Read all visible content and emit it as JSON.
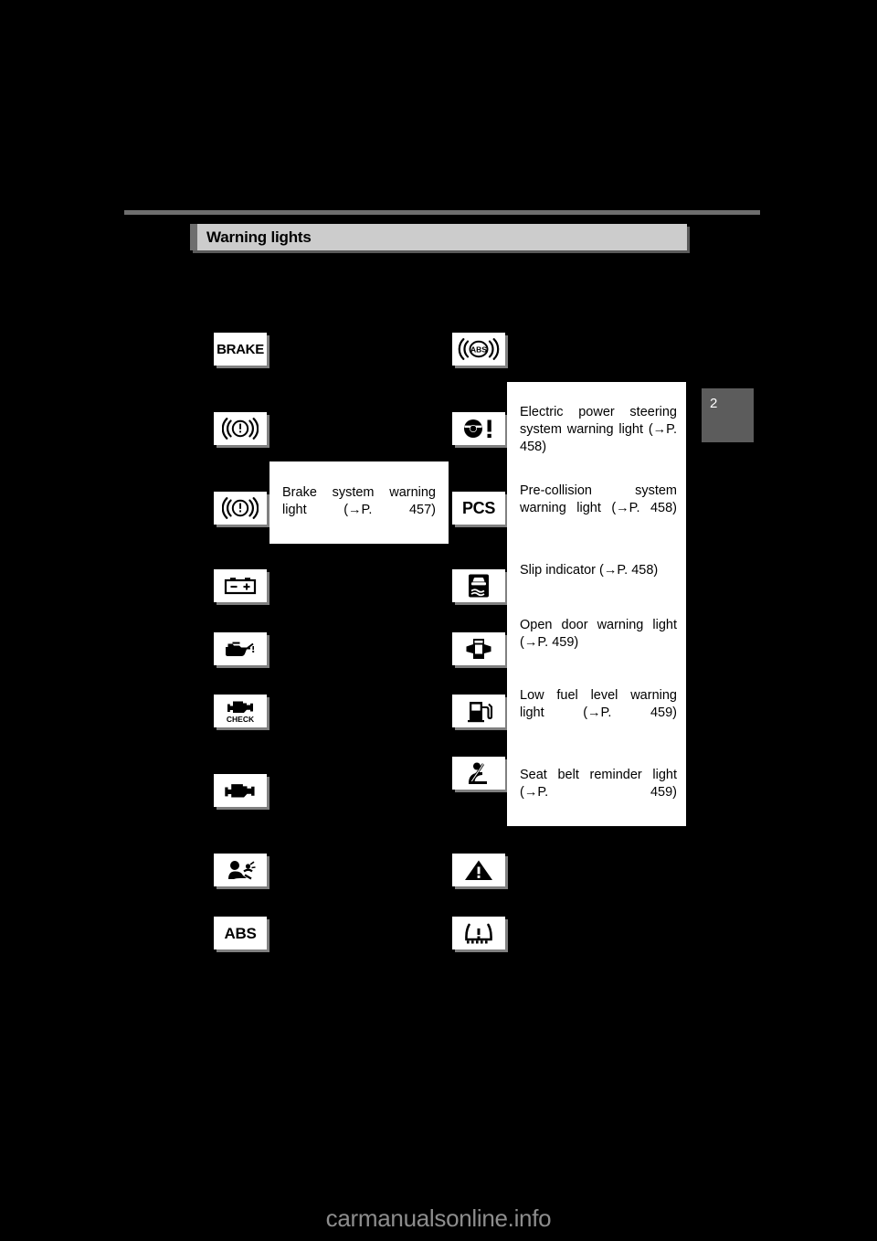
{
  "page": {
    "chapter_tab": "2",
    "watermark": "carmanualsonline.info",
    "background_color": "#000000",
    "header_bg": "#cccccc",
    "accent_color": "#6e6e6e"
  },
  "header": {
    "title": "Warning lights"
  },
  "left_column": {
    "icons": [
      {
        "name": "brake-warning-text-icon",
        "label": "BRAKE",
        "kind": "text"
      },
      {
        "name": "brake-system-warning-icon",
        "label": "",
        "kind": "brake-circle"
      },
      {
        "name": "brake-system-warning-icon-2",
        "label": "",
        "kind": "brake-circle"
      },
      {
        "name": "charging-system-warning-icon",
        "label": "",
        "kind": "battery"
      },
      {
        "name": "low-engine-oil-pressure-warning-icon",
        "label": "",
        "kind": "oil-can"
      },
      {
        "name": "check-engine-warning-icon",
        "label": "CHECK",
        "kind": "engine-check"
      },
      {
        "name": "malfunction-indicator-lamp-icon",
        "label": "",
        "kind": "engine"
      },
      {
        "name": "srs-airbag-warning-icon",
        "label": "",
        "kind": "airbag"
      },
      {
        "name": "abs-warning-text-icon",
        "label": "ABS",
        "kind": "text"
      }
    ]
  },
  "right_column": {
    "icons": [
      {
        "name": "abs-warning-icon",
        "label": "ABS",
        "kind": "abs-brackets"
      },
      {
        "name": "electric-power-steering-warning-icon",
        "label": "",
        "kind": "steering-wheel"
      },
      {
        "name": "pre-collision-system-warning-icon",
        "label": "PCS",
        "kind": "text"
      },
      {
        "name": "slip-indicator-icon",
        "label": "",
        "kind": "slip"
      },
      {
        "name": "open-door-warning-icon",
        "label": "",
        "kind": "open-door"
      },
      {
        "name": "low-fuel-level-warning-icon",
        "label": "",
        "kind": "fuel-pump"
      },
      {
        "name": "seat-belt-reminder-icon",
        "label": "",
        "kind": "seat-belt"
      },
      {
        "name": "master-warning-icon",
        "label": "",
        "kind": "warning-triangle"
      },
      {
        "name": "tire-pressure-warning-icon",
        "label": "",
        "kind": "tire-pressure"
      }
    ]
  },
  "callouts": {
    "left": {
      "text": "Brake system warning light (→P. 457)"
    },
    "right_entries": [
      {
        "text": "Electric power steering system warning light (→P. 458)"
      },
      {
        "text": "Pre-collision system warning light (→P. 458)"
      },
      {
        "text": "Slip indicator (→P. 458)"
      },
      {
        "text": "Open door warning light (→P. 459)"
      },
      {
        "text": "Low fuel level warning light (→P. 459)"
      },
      {
        "text": "Seat belt reminder light (→P. 459)"
      }
    ]
  }
}
